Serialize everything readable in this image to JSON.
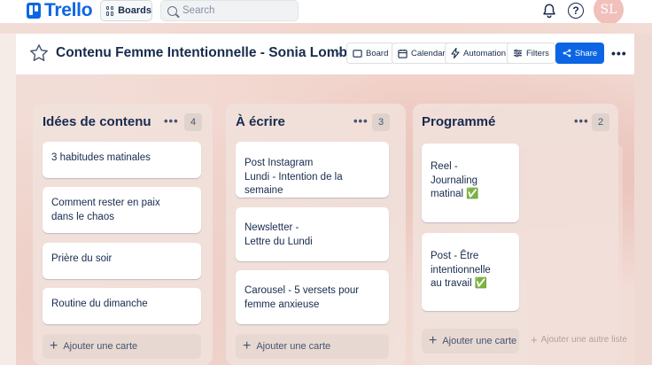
{
  "topnav": {
    "logo": "Trello",
    "boards_label": "Boards",
    "search_placeholder": "Search",
    "avatar_initials": "SL"
  },
  "board": {
    "title": "Contenu Femme Intentionnelle - Sonia Lombo",
    "views": [
      "Board",
      "Calendar",
      "Automation",
      "Filters"
    ],
    "share_label": "Share",
    "accent_color": "#0c66e4"
  },
  "lists": [
    {
      "title": "Idées de contenu",
      "count": "4",
      "cards": [
        "3 habitudes matinales",
        "Comment rester en paix\ndans le chaos",
        "Prière du soir",
        "Routine du dimanche"
      ],
      "add_label": "Ajouter une carte"
    },
    {
      "title": "À écrire",
      "count": "3",
      "cards": [
        "Post Instagram\nLundi - Intention de la semaine",
        "Newsletter -\nLettre du Lundi",
        "Carousel - 5 versets pour\nfemme anxieuse"
      ],
      "add_label": "Ajouter une carte"
    },
    {
      "title": "Programmé",
      "count": "2",
      "cards": [
        "Reel -\nJournaling\nmatinal ✅",
        "Post - Être\nintentionnelle\nau travail ✅"
      ],
      "add_label": "Ajouter une carte"
    }
  ],
  "add_list_label": "Ajouter une autre liste"
}
